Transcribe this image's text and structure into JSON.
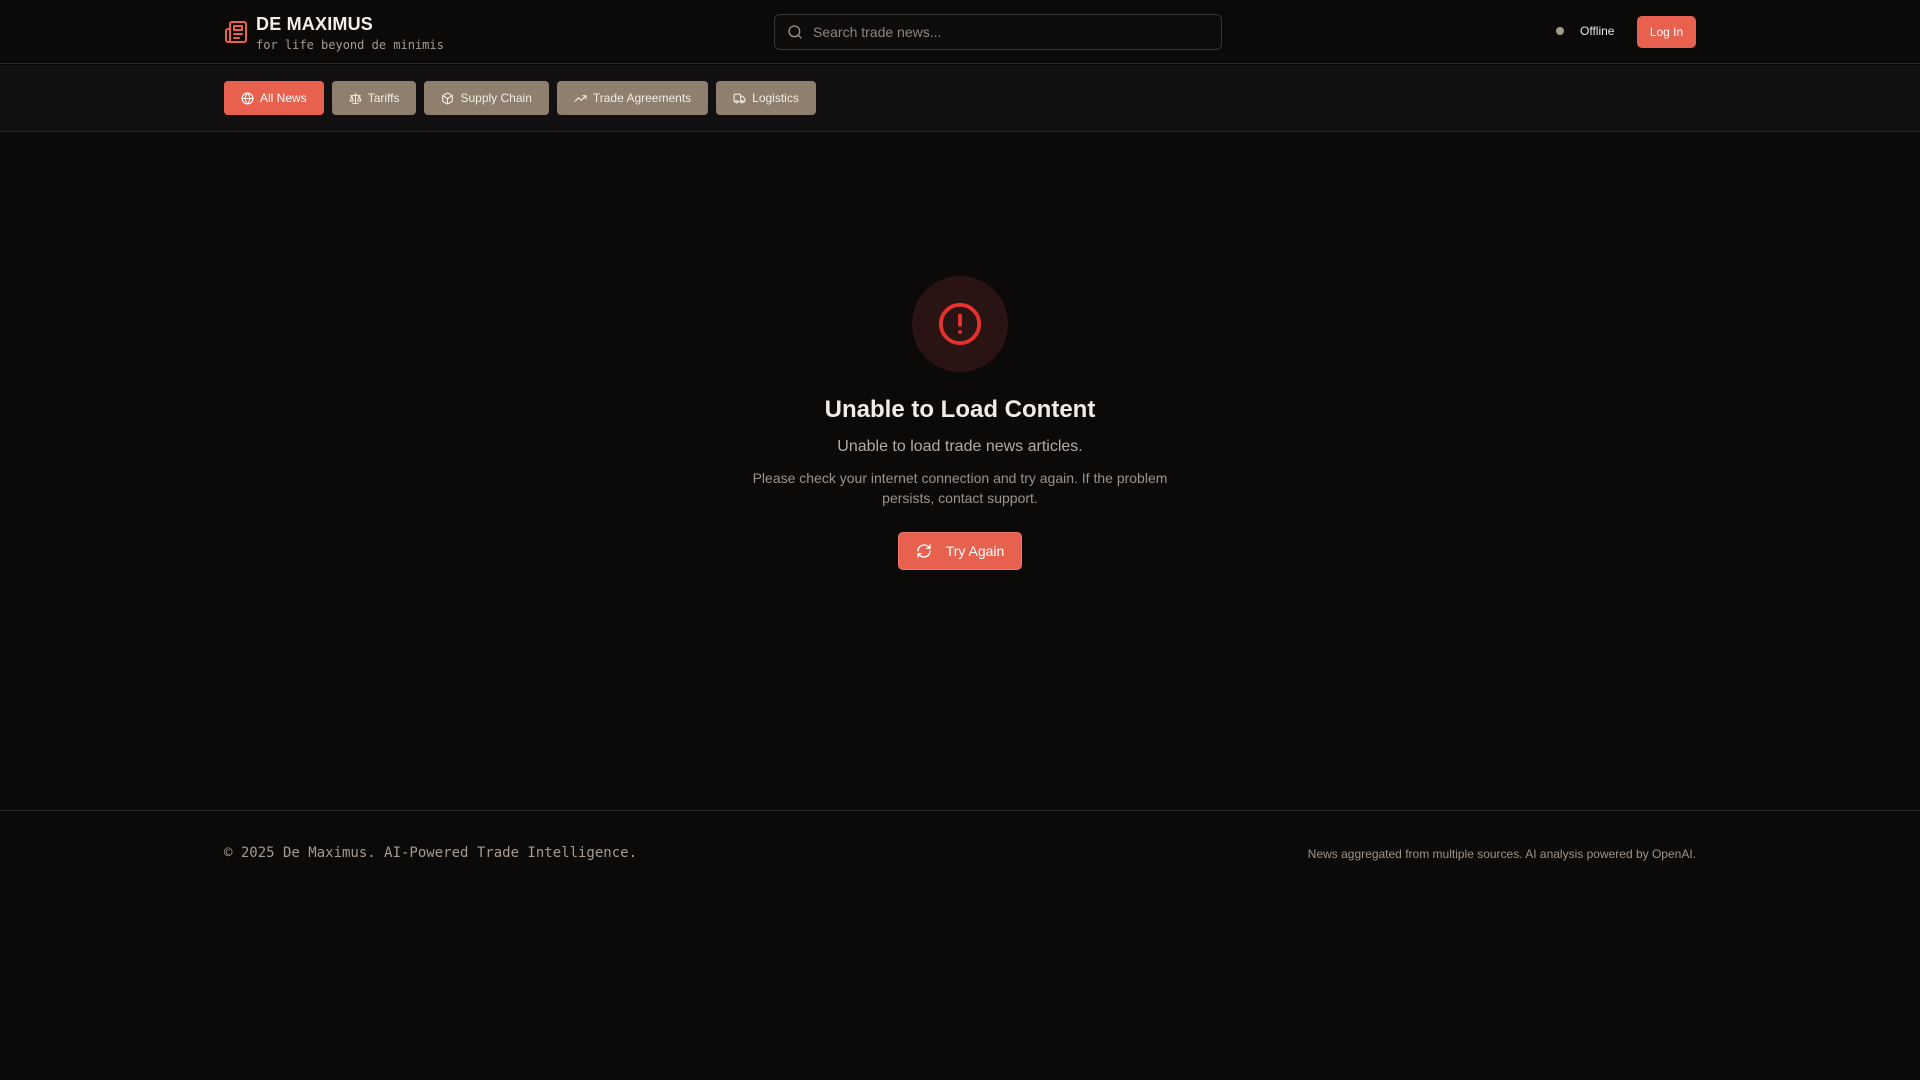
{
  "brand": {
    "title": "DE MAXIMUS",
    "tagline": "for life beyond de minimis",
    "icon": "newspaper-icon",
    "accent_color": "#e8614f"
  },
  "search": {
    "placeholder": "Search trade news...",
    "value": ""
  },
  "status": {
    "label": "Offline",
    "dot_color": "#a39a8a"
  },
  "auth": {
    "login_label": "Log In"
  },
  "categories": [
    {
      "label": "All News",
      "icon": "globe-icon",
      "active": true
    },
    {
      "label": "Tariffs",
      "icon": "scale-icon",
      "active": false
    },
    {
      "label": "Supply Chain",
      "icon": "package-icon",
      "active": false
    },
    {
      "label": "Trade Agreements",
      "icon": "trending-up-icon",
      "active": false
    },
    {
      "label": "Logistics",
      "icon": "truck-icon",
      "active": false
    }
  ],
  "error": {
    "icon": "alert-circle-icon",
    "title": "Unable to Load Content",
    "subtitle": "Unable to load trade news articles.",
    "description": "Please check your internet connection and try again. If the problem persists, contact support.",
    "retry_label": "Try Again",
    "retry_icon": "refresh-icon",
    "error_color": "#e5322d"
  },
  "footer": {
    "copyright": "© 2025 De Maximus. AI-Powered Trade Intelligence.",
    "note": "News aggregated from multiple sources. AI analysis powered by OpenAI."
  }
}
